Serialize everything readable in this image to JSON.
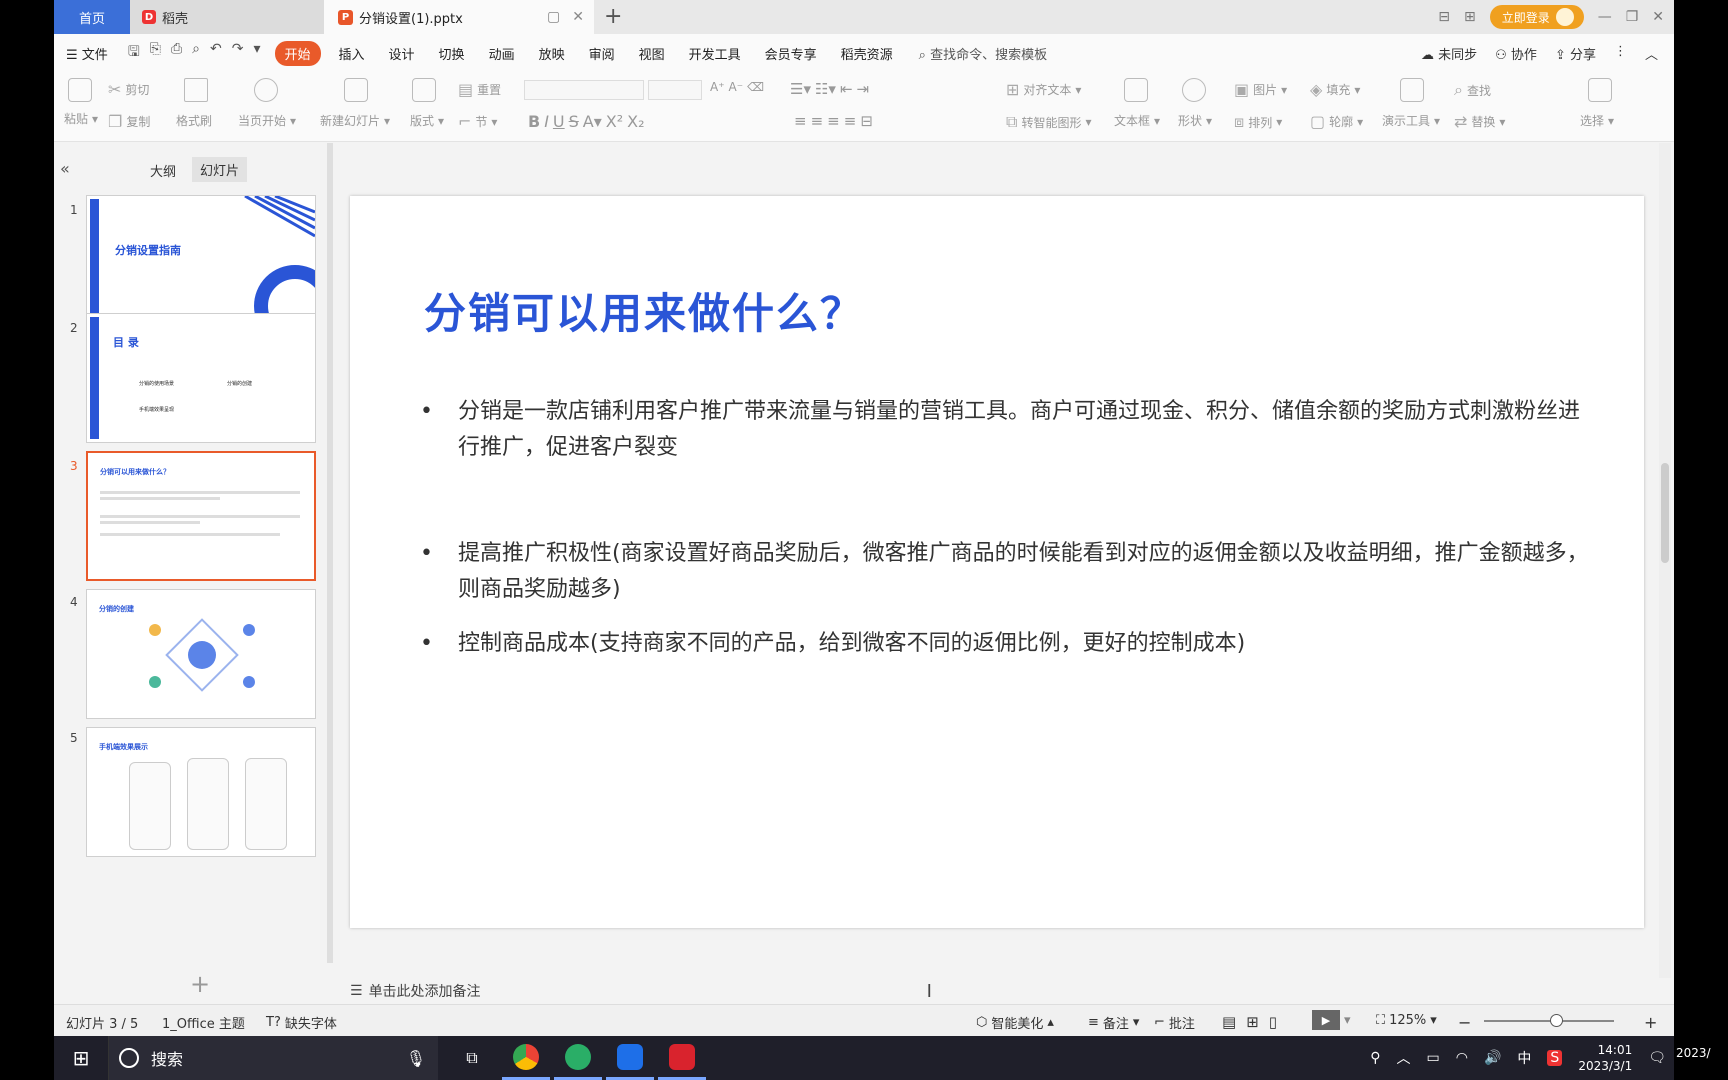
{
  "tabs": {
    "home": "首页",
    "daoke": "稻壳",
    "file": "分销设置(1).pptx",
    "new_tab": "+"
  },
  "titlebar_right": {
    "login": "立即登录"
  },
  "menu": {
    "file": "文件",
    "items": [
      "开始",
      "插入",
      "设计",
      "切换",
      "动画",
      "放映",
      "审阅",
      "视图",
      "开发工具",
      "会员专享",
      "稻壳资源"
    ],
    "search": "查找命令、搜索模板",
    "sync": "未同步",
    "collab": "协作",
    "share": "分享"
  },
  "ribbon": {
    "paste": "粘贴",
    "cut": "剪切",
    "copy": "复制",
    "format_painter": "格式刷",
    "from_current": "当页开始",
    "new_slide": "新建幻灯片",
    "layout": "版式",
    "section": "节",
    "reset": "重置",
    "align_text": "对齐文本",
    "smart_graphic": "转智能图形",
    "textbox": "文本框",
    "shape": "形状",
    "picture": "图片",
    "fill": "填充",
    "arrange": "排列",
    "outline": "轮廓",
    "presentation_tools": "演示工具",
    "find": "查找",
    "replace": "替换",
    "select": "选择"
  },
  "panel": {
    "outline_tab": "大纲",
    "slides_tab": "幻灯片",
    "thumbnails": [
      {
        "num": "1",
        "title": "分销设置指南"
      },
      {
        "num": "2",
        "title": "目 录",
        "items": [
          "分销的使用场景",
          "分销的创建",
          "手机端效果呈现"
        ]
      },
      {
        "num": "3",
        "title": "分销可以用来做什么？"
      },
      {
        "num": "4",
        "title": "分销的创建"
      },
      {
        "num": "5",
        "title": "手机端效果展示"
      }
    ]
  },
  "slide": {
    "title": "分销可以用来做什么？",
    "bullets": [
      "分销是一款店铺利用客户推广带来流量与销量的营销工具。商户可通过现金、积分、储值余额的奖励方式刺激粉丝进行推广，促进客户裂变",
      "提高推广积极性(商家设置好商品奖励后，微客推广商品的时候能看到对应的返佣金额以及收益明细，推广金额越多，则商品奖励越多)",
      "控制商品成本(支持商家不同的产品，给到微客不同的返佣比例，更好的控制成本)"
    ],
    "bullet_symbol": "•"
  },
  "notes_placeholder": "单击此处添加备注",
  "status": {
    "slide_index": "幻灯片 3 / 5",
    "theme": "1_Office 主题",
    "missing_font": "缺失字体",
    "beautify": "智能美化",
    "notes": "备注",
    "comments": "批注",
    "zoom": "125%",
    "zoom_fraction": 0.55
  },
  "taskbar": {
    "search": "搜索",
    "time": "14:01",
    "date": "2023/3/1",
    "ime": "中",
    "date_cut": "2023/"
  },
  "colors": {
    "accent": "#e95a2a",
    "slide_title": "#2a55d6",
    "tab_home": "#3b6fd8"
  }
}
